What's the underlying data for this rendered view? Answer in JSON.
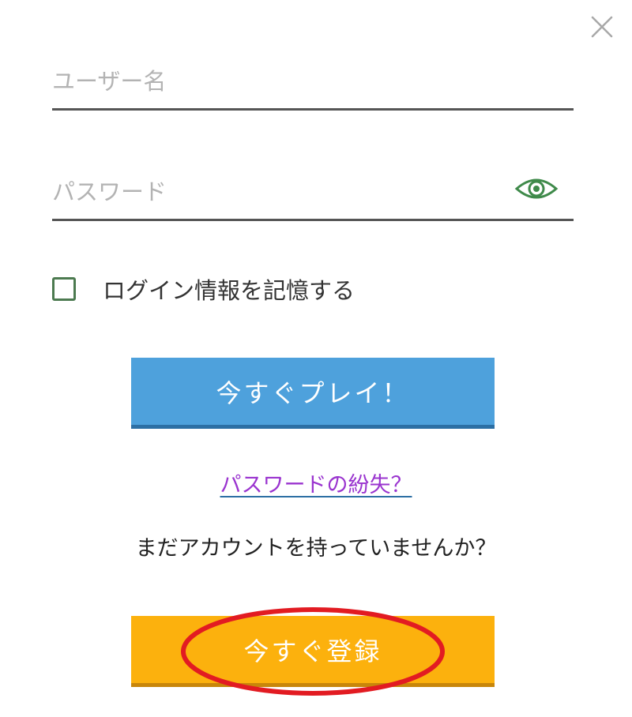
{
  "login": {
    "username_placeholder": "ユーザー名",
    "username_value": "",
    "password_placeholder": "パスワード",
    "password_value": "",
    "remember_label": "ログイン情報を記憶する",
    "remember_checked": false,
    "play_button": "今すぐプレイ！",
    "forgot_password": "パスワードの紛失？",
    "no_account_text": "まだアカウントを持っていませんか？",
    "register_button": "今すぐ登録"
  },
  "icons": {
    "close": "close-icon",
    "show_password": "eye-icon"
  },
  "colors": {
    "play_button": "#4ea1dc",
    "register_button": "#fcb10d",
    "link": "#9a34cf",
    "accent_green": "#4c7a50",
    "highlight_ring": "#e21b22"
  }
}
